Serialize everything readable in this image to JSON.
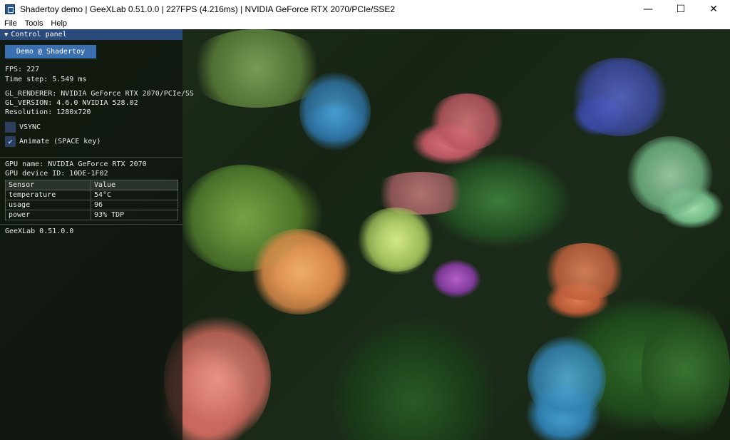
{
  "window": {
    "title": "Shadertoy demo | GeeXLab 0.51.0.0 | 227FPS (4.216ms) | NVIDIA GeForce RTX 2070/PCIe/SSE2",
    "controls": {
      "minimize": "—",
      "maximize": "☐",
      "close": "✕"
    }
  },
  "menubar": {
    "items": [
      "File",
      "Tools",
      "Help"
    ]
  },
  "panel": {
    "header": "Control panel",
    "demo_button": "Demo @ Shadertoy",
    "fps": "FPS: 227",
    "time_step": "Time step: 5.549 ms",
    "gl_renderer": "GL_RENDERER: NVIDIA GeForce RTX 2070/PCIe/SS",
    "gl_version": "GL_VERSION: 4.6.0 NVIDIA 528.02",
    "resolution": "Resolution: 1280x720",
    "vsync": {
      "label": "VSYNC",
      "checked": false
    },
    "animate": {
      "label": "Animate (SPACE key)",
      "checked": true
    },
    "gpu_name": "GPU name: NVIDIA GeForce RTX 2070",
    "gpu_device_id": "GPU device ID: 10DE-1F02",
    "sensor_table": {
      "headers": [
        "Sensor",
        "Value"
      ],
      "rows": [
        [
          "temperature",
          "54°C"
        ],
        [
          "usage",
          "96"
        ],
        [
          "power",
          "93% TDP"
        ]
      ]
    },
    "footer": "GeeXLab 0.51.0.0"
  },
  "colors": {
    "panel_header": "#294a7a",
    "button": "#3a6fb0",
    "checkbox": "#2d3f5c"
  }
}
